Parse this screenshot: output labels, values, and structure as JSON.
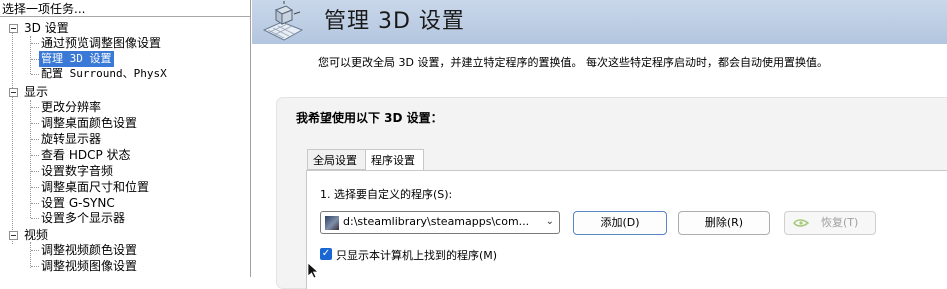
{
  "left_panel": {
    "title": "选择一项任务...",
    "categories": [
      {
        "label": "3D 设置",
        "items": [
          "通过预览调整图像设置",
          "管理 3D 设置",
          "配置 Surround、PhysX"
        ]
      },
      {
        "label": "显示",
        "items": [
          "更改分辨率",
          "调整桌面颜色设置",
          "旋转显示器",
          "查看 HDCP 状态",
          "设置数字音频",
          "调整桌面尺寸和位置",
          "设置 G-SYNC",
          "设置多个显示器"
        ]
      },
      {
        "label": "视频",
        "items": [
          "调整视频颜色设置",
          "调整视频图像设置"
        ]
      }
    ],
    "selected_item": "管理 3D 设置"
  },
  "header": {
    "title": "管理 3D 设置",
    "description": "您可以更改全局 3D 设置，并建立特定程序的置换值。 每次这些特定程序启动时，都会自动使用置换值。"
  },
  "settings": {
    "heading": "我希望使用以下 3D 设置：",
    "tabs": [
      "全局设置",
      "程序设置"
    ],
    "active_tab": "程序设置",
    "select_label": "1. 选择要自定义的程序(S):",
    "program_value": "d:\\steamlibrary\\steamapps\\com...",
    "add_button": "添加(D)",
    "delete_button": "删除(R)",
    "restore_button": "恢复(T)",
    "only_installed_checkbox": "只显示本计算机上找到的程序(M)",
    "only_installed_checked": true
  },
  "colors": {
    "selection": "#3a7ad6",
    "banner": "#b9cbe2",
    "checkbox": "#1a66d2",
    "nvidia_green": "#76b900"
  }
}
